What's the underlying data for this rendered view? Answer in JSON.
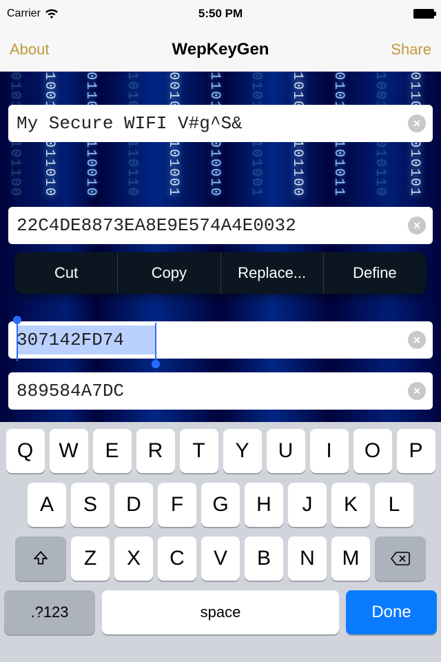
{
  "status": {
    "carrier": "Carrier",
    "time": "5:50 PM"
  },
  "nav": {
    "left": "About",
    "title": "WepKeyGen",
    "right": "Share"
  },
  "fields": {
    "f1": "My Secure WIFI V#g^S&",
    "f2": "22C4DE8873EA8E9E574A4E0032",
    "f3": "307142FD74",
    "f4": "889584A7DC"
  },
  "editMenu": {
    "cut": "Cut",
    "copy": "Copy",
    "replace": "Replace...",
    "define": "Define"
  },
  "keyboard": {
    "row1": [
      "Q",
      "W",
      "E",
      "R",
      "T",
      "Y",
      "U",
      "I",
      "O",
      "P"
    ],
    "row2": [
      "A",
      "S",
      "D",
      "F",
      "G",
      "H",
      "J",
      "K",
      "L"
    ],
    "row3": [
      "Z",
      "X",
      "C",
      "V",
      "B",
      "N",
      "M"
    ],
    "mode": ".?123",
    "space": "space",
    "done": "Done"
  }
}
